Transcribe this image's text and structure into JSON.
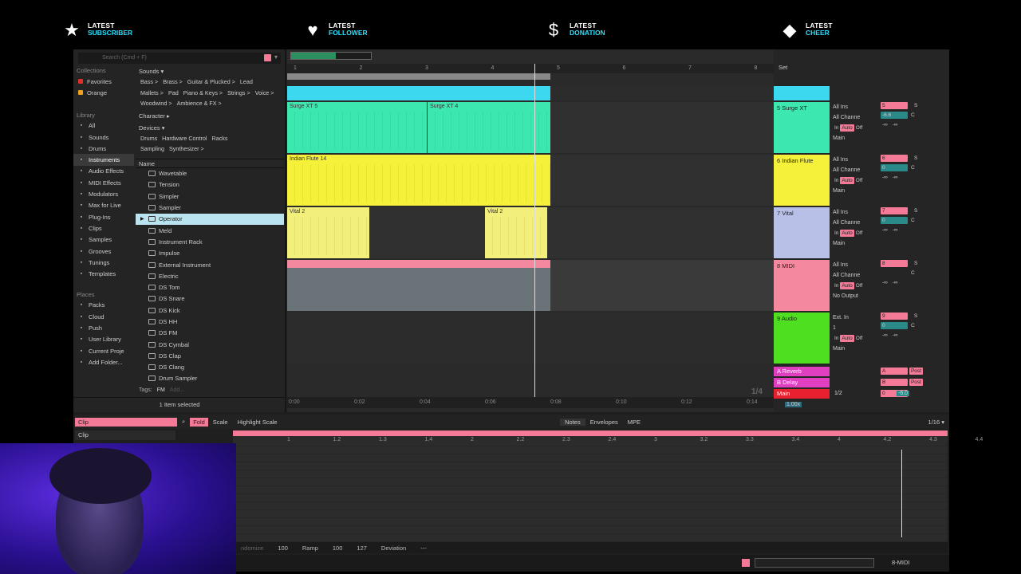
{
  "overlay": [
    {
      "icon": "star-icon",
      "glyph": "★",
      "line1": "LATEST",
      "line2": "SUBSCRIBER"
    },
    {
      "icon": "heart-icon",
      "glyph": "♥",
      "line1": "LATEST",
      "line2": "FOLLOWER"
    },
    {
      "icon": "dollar-icon",
      "glyph": "$",
      "line1": "LATEST",
      "line2": "DONATION"
    },
    {
      "icon": "diamond-icon",
      "glyph": "◆",
      "line1": "LATEST",
      "line2": "CHEER"
    }
  ],
  "browser": {
    "search_placeholder": "Search (Cmd + F)",
    "collections_hdr": "Collections",
    "collections": [
      {
        "label": "Favorites",
        "color": "#e0302a"
      },
      {
        "label": "Orange",
        "color": "#f0a020"
      }
    ],
    "library_hdr": "Library",
    "library": [
      "All",
      "Sounds",
      "Drums",
      "Instruments",
      "Audio Effects",
      "MIDI Effects",
      "Modulators",
      "Max for Live",
      "Plug-Ins",
      "Clips",
      "Samples",
      "Grooves",
      "Tunings",
      "Templates"
    ],
    "selected_library": "Instruments",
    "places_hdr": "Places",
    "places": [
      "Packs",
      "Cloud",
      "Push",
      "User Library",
      "Current Proje",
      "Add Folder..."
    ],
    "sounds_hdr": "Sounds ▾",
    "sounds_tags": [
      "Bass >",
      "Brass >",
      "Guitar & Plucked >",
      "Lead",
      "Mallets >",
      "Pad",
      "Piano & Keys >",
      "Strings >",
      "Voice >",
      "Woodwind >",
      "Ambience & FX >"
    ],
    "character_hdr": "Character ▸",
    "devices_hdr": "Devices ▾",
    "devices_tags": [
      "Drums",
      "Hardware Control",
      "Racks",
      "Sampling",
      "Synthesizer >"
    ],
    "name_hdr": "Name",
    "files": [
      "Wavetable",
      "Tension",
      "Simpler",
      "Sampler",
      "Operator",
      "Meld",
      "Instrument Rack",
      "Impulse",
      "External Instrument",
      "Electric",
      "DS Tom",
      "DS Snare",
      "DS Kick",
      "DS HH",
      "DS FM",
      "DS Cymbal",
      "DS Clap",
      "DS Clang",
      "Drum Sampler"
    ],
    "selected_file": "Operator",
    "tags_label": "Tags:",
    "tags_fm": "FM",
    "tags_add": "Add...",
    "status": "1 Item selected"
  },
  "arrangement": {
    "bars": [
      "1",
      "2",
      "3",
      "4",
      "5",
      "6",
      "7",
      "8"
    ],
    "clips": [
      {
        "name": "Surge XT 5",
        "color": "#3de8b0"
      },
      {
        "name": "Surge XT 4",
        "color": "#3de8b0"
      },
      {
        "name": "Indian Flute 14",
        "color": "#f5f03a"
      },
      {
        "name": "Vital 2",
        "color": "#f2f07a"
      },
      {
        "name": "Vital 2",
        "color": "#f2f07a"
      }
    ],
    "times": [
      "0:00",
      "0:02",
      "0:04",
      "0:06",
      "0:08",
      "0:10",
      "0:12",
      "0:14"
    ],
    "quant": "1/4"
  },
  "mixer": {
    "set_label": "Set",
    "tracks": [
      {
        "name": "5 Surge XT",
        "color": "#3de8b0",
        "input": "All Ins",
        "channel": "All Channe",
        "out": "Main",
        "num": "5",
        "vol": "-6.6"
      },
      {
        "name": "6 Indian Flute",
        "color": "#f5f03a",
        "input": "All Ins",
        "channel": "All Channe",
        "out": "Main",
        "num": "6",
        "vol": "0"
      },
      {
        "name": "7 Vital",
        "color": "#b8c0e8",
        "input": "All Ins",
        "channel": "All Channe",
        "out": "Main",
        "num": "7",
        "vol": "0"
      },
      {
        "name": "8 MIDI",
        "color": "#f4889e",
        "input": "All Ins",
        "channel": "All Channe",
        "out": "No Output",
        "num": "8",
        "vol": ""
      },
      {
        "name": "9 Audio",
        "color": "#4ee020",
        "input": "Ext. In",
        "channel": "1",
        "out": "Main",
        "num": "9",
        "vol": "0"
      }
    ],
    "returns": [
      {
        "name": "A Reverb",
        "color": "#e040c0",
        "num": "A"
      },
      {
        "name": "B Delay",
        "color": "#e040c0",
        "num": "B"
      },
      {
        "name": "Main",
        "color": "#e82030",
        "num": "0"
      }
    ],
    "in_label": "In",
    "auto_label": "Auto",
    "off_label": "Off",
    "inf": "-∞",
    "post": "Post",
    "main_ratio": "1/2",
    "main_vol": "-6.0",
    "zoom": "1.00x"
  },
  "detail": {
    "clip_label": "Clip",
    "clip_label2": "Clip",
    "fold": "Fold",
    "scale": "Scale",
    "highlight": "Highlight Scale",
    "tabs": [
      "Notes",
      "Envelopes",
      "MPE"
    ],
    "grid": "1/16 ▾",
    "ruler": [
      "1",
      "1.2",
      "1.3",
      "1.4",
      "2",
      "2.2",
      "2.3",
      "2.4",
      "3",
      "3.2",
      "3.3",
      "3.4",
      "4",
      "4.2",
      "4.3",
      "4.4"
    ],
    "randomize": "ndomize",
    "vel": "100",
    "ramp_label": "Ramp",
    "ramp": "100",
    "v127": "127",
    "dev_label": "Deviation",
    "dev": "---",
    "track_label": "8-MIDI"
  }
}
